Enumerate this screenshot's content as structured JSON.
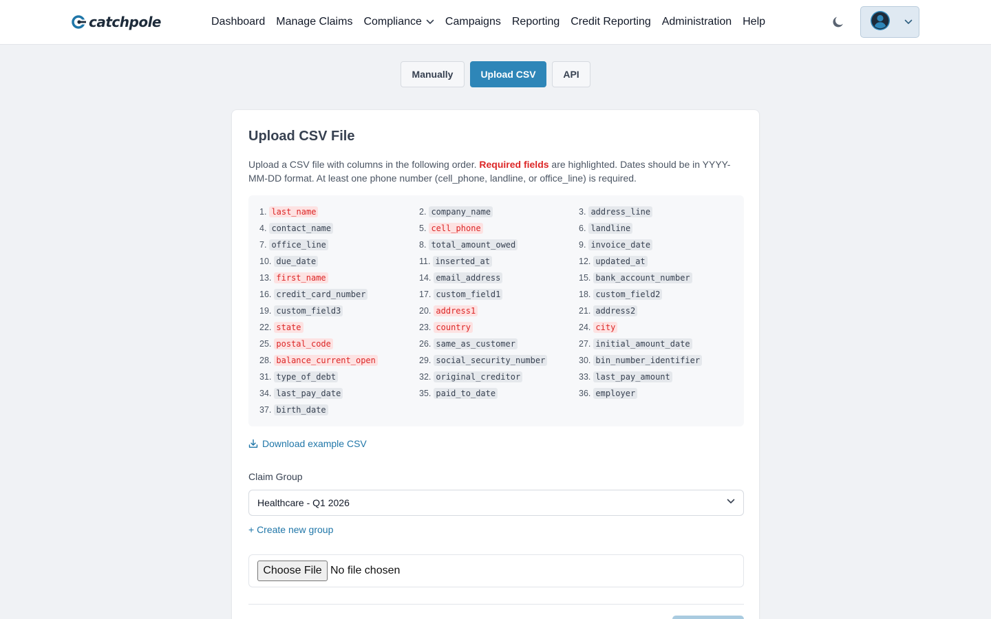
{
  "header": {
    "logo_text": "catchpole",
    "nav": [
      {
        "label": "Dashboard"
      },
      {
        "label": "Manage Claims"
      },
      {
        "label": "Compliance",
        "has_dropdown": true
      },
      {
        "label": "Campaigns"
      },
      {
        "label": "Reporting"
      },
      {
        "label": "Credit Reporting"
      },
      {
        "label": "Administration"
      },
      {
        "label": "Help"
      }
    ],
    "theme_toggle_icon": "moon-icon",
    "user_menu_icon": "user-avatar-icon"
  },
  "tabs": [
    {
      "label": "Manually",
      "active": false
    },
    {
      "label": "Upload CSV",
      "active": true
    },
    {
      "label": "API",
      "active": false
    }
  ],
  "upload": {
    "title": "Upload CSV File",
    "description_1": "Upload a CSV file with columns in the following order. ",
    "required_text": "Required fields",
    "description_2": " are highlighted. Dates should be in YYYY-MM-DD format. At least one phone number (cell_phone, landline, or office_line) is required.",
    "fields": [
      {
        "n": "1.",
        "name": "last_name",
        "required": true
      },
      {
        "n": "2.",
        "name": "company_name",
        "required": false
      },
      {
        "n": "3.",
        "name": "address_line",
        "required": false
      },
      {
        "n": "4.",
        "name": "contact_name",
        "required": false
      },
      {
        "n": "5.",
        "name": "cell_phone",
        "required": true
      },
      {
        "n": "6.",
        "name": "landline",
        "required": false
      },
      {
        "n": "7.",
        "name": "office_line",
        "required": false
      },
      {
        "n": "8.",
        "name": "total_amount_owed",
        "required": false
      },
      {
        "n": "9.",
        "name": "invoice_date",
        "required": false
      },
      {
        "n": "10.",
        "name": "due_date",
        "required": false
      },
      {
        "n": "11.",
        "name": "inserted_at",
        "required": false
      },
      {
        "n": "12.",
        "name": "updated_at",
        "required": false
      },
      {
        "n": "13.",
        "name": "first_name",
        "required": true
      },
      {
        "n": "14.",
        "name": "email_address",
        "required": false
      },
      {
        "n": "15.",
        "name": "bank_account_number",
        "required": false
      },
      {
        "n": "16.",
        "name": "credit_card_number",
        "required": false
      },
      {
        "n": "17.",
        "name": "custom_field1",
        "required": false
      },
      {
        "n": "18.",
        "name": "custom_field2",
        "required": false
      },
      {
        "n": "19.",
        "name": "custom_field3",
        "required": false
      },
      {
        "n": "20.",
        "name": "address1",
        "required": true
      },
      {
        "n": "21.",
        "name": "address2",
        "required": false
      },
      {
        "n": "22.",
        "name": "state",
        "required": true
      },
      {
        "n": "23.",
        "name": "country",
        "required": true
      },
      {
        "n": "24.",
        "name": "city",
        "required": true
      },
      {
        "n": "25.",
        "name": "postal_code",
        "required": true
      },
      {
        "n": "26.",
        "name": "same_as_customer",
        "required": false
      },
      {
        "n": "27.",
        "name": "initial_amount_date",
        "required": false
      },
      {
        "n": "28.",
        "name": "balance_current_open",
        "required": true
      },
      {
        "n": "29.",
        "name": "social_security_number",
        "required": false
      },
      {
        "n": "30.",
        "name": "bin_number_identifier",
        "required": false
      },
      {
        "n": "31.",
        "name": "type_of_debt",
        "required": false
      },
      {
        "n": "32.",
        "name": "original_creditor",
        "required": false
      },
      {
        "n": "33.",
        "name": "last_pay_amount",
        "required": false
      },
      {
        "n": "34.",
        "name": "last_pay_date",
        "required": false
      },
      {
        "n": "35.",
        "name": "paid_to_date",
        "required": false
      },
      {
        "n": "36.",
        "name": "employer",
        "required": false
      },
      {
        "n": "37.",
        "name": "birth_date",
        "required": false
      }
    ],
    "download_label": "Download example CSV",
    "claim_group_label": "Claim Group",
    "claim_group_value": "Healthcare - Q1 2026",
    "create_group_label": "+ Create new group",
    "file_button_label": "Choose File",
    "file_status": "No file chosen"
  },
  "colors": {
    "accent": "#2e86b8",
    "link": "#1f76a8",
    "required": "#dc2626",
    "background": "#f0f2f5"
  }
}
